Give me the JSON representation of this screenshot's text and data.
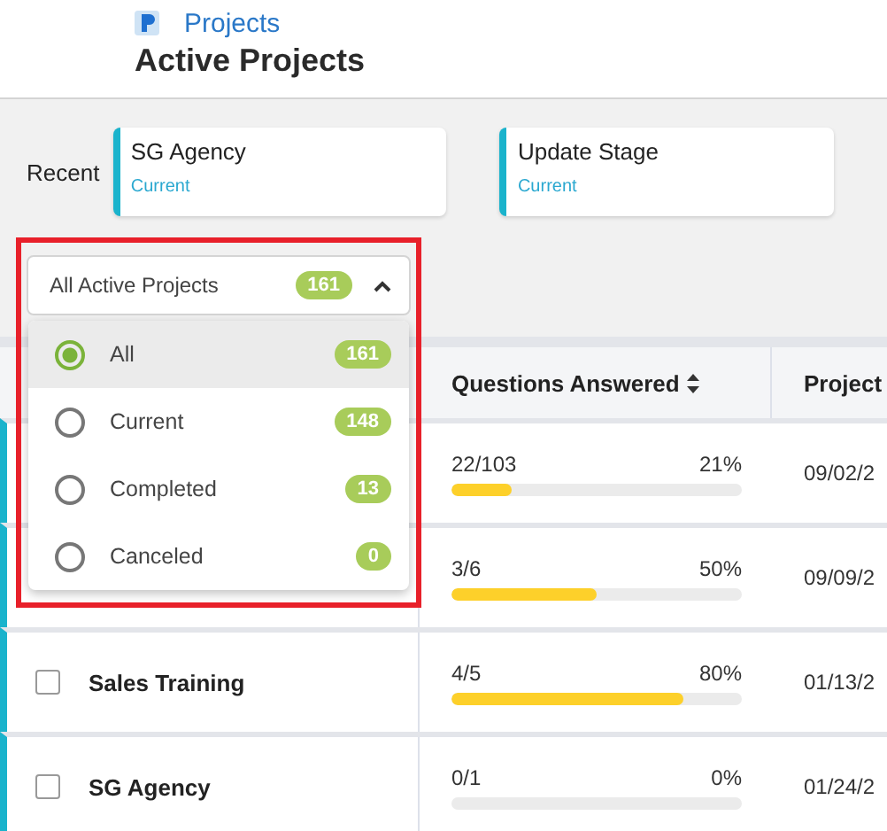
{
  "header": {
    "breadcrumb": "Projects",
    "title": "Active Projects"
  },
  "recent": {
    "label": "Recent",
    "cards": [
      {
        "name": "SG Agency",
        "status": "Current"
      },
      {
        "name": "Update Stage",
        "status": "Current"
      }
    ]
  },
  "filter": {
    "label": "All Active Projects",
    "count": "161",
    "expanded": true,
    "highlighted": true,
    "options": [
      {
        "label": "All",
        "count": "161",
        "selected": true
      },
      {
        "label": "Current",
        "count": "148",
        "selected": false
      },
      {
        "label": "Completed",
        "count": "13",
        "selected": false
      },
      {
        "label": "Canceled",
        "count": "0",
        "selected": false
      }
    ]
  },
  "table": {
    "columns": [
      "Questions Answered",
      "Project"
    ],
    "rows": [
      {
        "answered": "22/103",
        "percent": "21%",
        "level": 0.21,
        "date": "09/02/2"
      },
      {
        "answered": "3/6",
        "percent": "50%",
        "level": 0.5,
        "date": "09/09/2"
      },
      {
        "name": "Sales Training",
        "checked": false,
        "answered": "4/5",
        "percent": "80%",
        "level": 0.8,
        "date": "01/13/2"
      },
      {
        "name": "SG Agency",
        "checked": false,
        "answered": "0/1",
        "percent": "0%",
        "level": 0,
        "date": "01/24/2"
      }
    ]
  }
}
